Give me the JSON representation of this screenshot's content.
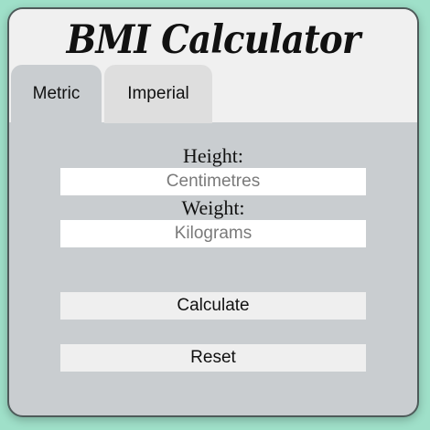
{
  "app": {
    "title": "BMI Calculator"
  },
  "tabs": [
    {
      "label": "Metric",
      "active": true
    },
    {
      "label": "Imperial",
      "active": false
    }
  ],
  "form": {
    "height_label": "Height:",
    "height_placeholder": "Centimetres",
    "height_value": "",
    "weight_label": "Weight:",
    "weight_placeholder": "Kilograms",
    "weight_value": ""
  },
  "buttons": {
    "calculate_label": "Calculate",
    "reset_label": "Reset"
  },
  "colors": {
    "page_background": "#9fe0c9",
    "panel_background": "#c9cdd0",
    "header_background": "#f0f0f0",
    "inactive_tab": "#dedede",
    "border": "#4e5b5a"
  }
}
